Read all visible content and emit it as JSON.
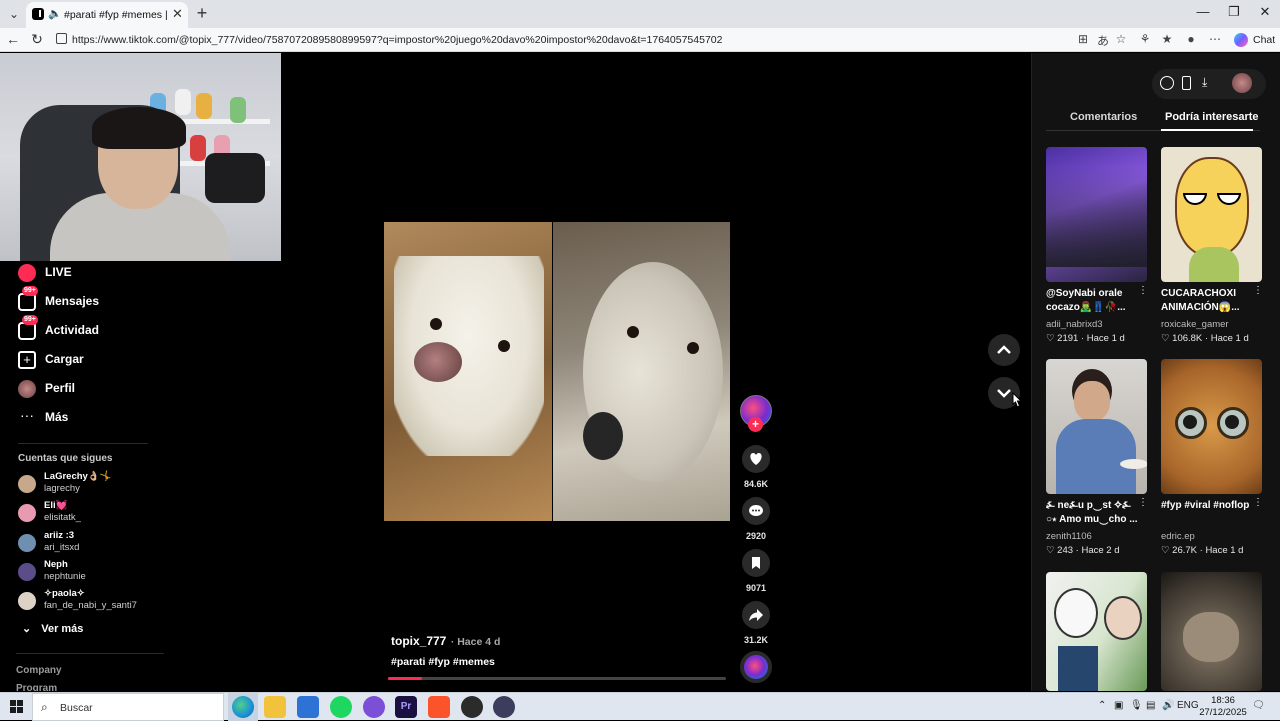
{
  "browser": {
    "tab_title": "#parati #fyp #memes | TikTok",
    "url": "https://www.tiktok.com/@topix_777/video/7587072089580899597?q=impostor%20juego%20davo%20impostor%20davo&t=1764057545702",
    "chat_label": "Chat"
  },
  "sidebar": {
    "nav": [
      {
        "label": "LIVE",
        "icon": "live-icon"
      },
      {
        "label": "Mensajes",
        "icon": "messages-icon",
        "badge": "99+"
      },
      {
        "label": "Actividad",
        "icon": "activity-icon",
        "badge": "99+"
      },
      {
        "label": "Cargar",
        "icon": "upload-icon"
      },
      {
        "label": "Perfil",
        "icon": "profile-avatar-icon"
      },
      {
        "label": "Más",
        "icon": "more-dots-icon"
      }
    ],
    "following_title": "Cuentas que sigues",
    "following": [
      {
        "name": "LaGrechy👌🏼🤸",
        "user": "lagrechy",
        "color": "#c8a88a"
      },
      {
        "name": "Eli💓",
        "user": "elisitatk_",
        "color": "#e89ab0"
      },
      {
        "name": "ariiz :3",
        "user": "ari_itsxd",
        "color": "#6f8fb0"
      },
      {
        "name": "Neph",
        "user": "nephtunie",
        "color": "#5b4c8a"
      },
      {
        "name": "✧paola✧",
        "user": "fan_de_nabi_y_santi7",
        "color": "#dcd3c6"
      }
    ],
    "see_more": "Ver más",
    "footer": [
      "Company",
      "Program"
    ]
  },
  "video": {
    "author": "topix_777",
    "ago": "· Hace 4 d",
    "caption": "#parati #fyp #memes",
    "progress": 0.1,
    "likes": "84.6K",
    "comments": "2920",
    "saves": "9071",
    "shares": "31.2K"
  },
  "right_panel": {
    "tabs": [
      "Comentarios",
      "Podría interesarte"
    ],
    "active_tab": 1,
    "cards": [
      {
        "title": "@SoyNabi orale cocazo🧟‍♂️👖🥀...",
        "user": "adii_nabrixd3",
        "likes": "2191",
        "ago": "Hace 1 d"
      },
      {
        "title": "CUCARACHOXI ANIMACIÓN😱...",
        "user": "roxicake_gamer",
        "likes": "106.8K",
        "ago": "Hace 1 d"
      },
      {
        "title": "⍼ ne⍼u p‿st ✧⍼ ○⋆ Amo mu‿cho ...",
        "user": "zenith1106",
        "likes": "243",
        "ago": "Hace 2 d"
      },
      {
        "title": "#fyp #viral #noflop",
        "user": "edric.ep",
        "likes": "26.7K",
        "ago": "Hace 1 d"
      },
      {
        "title": "",
        "user": "",
        "likes": "",
        "ago": ""
      },
      {
        "title": "",
        "user": "",
        "likes": "",
        "ago": ""
      }
    ]
  },
  "taskbar": {
    "search_placeholder": "Buscar",
    "lang": "ENG",
    "time": "18:36",
    "date": "27/12/2025"
  },
  "colors": {
    "accent": "#fe2c55",
    "background": "#000000",
    "panel": "#121212"
  }
}
